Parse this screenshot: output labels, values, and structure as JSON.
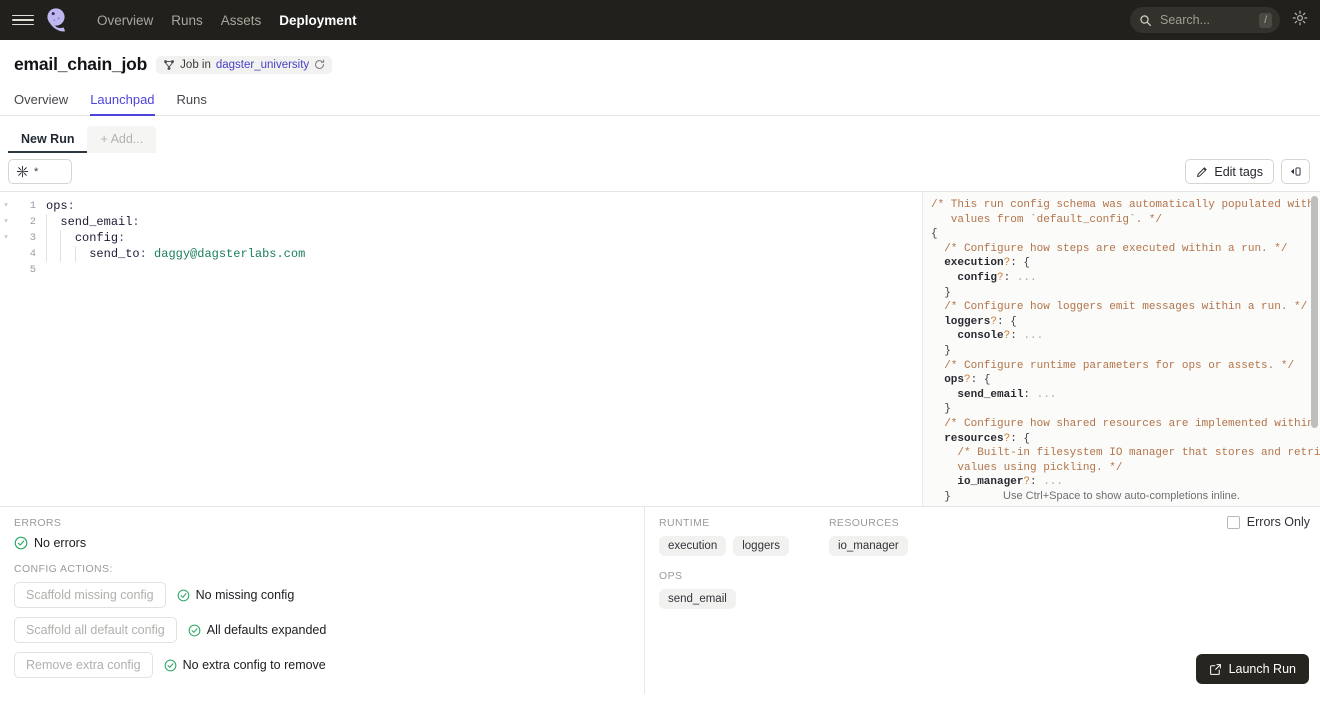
{
  "topnav": {
    "menu_icon": "hamburger-icon",
    "logo_icon": "dagster-logo-icon",
    "links": [
      {
        "label": "Overview",
        "active": false
      },
      {
        "label": "Runs",
        "active": false
      },
      {
        "label": "Assets",
        "active": false
      },
      {
        "label": "Deployment",
        "active": true
      }
    ],
    "search": {
      "placeholder": "Search...",
      "shortcut": "/",
      "icon": "search-icon"
    },
    "settings_icon": "gear-icon"
  },
  "job": {
    "title": "email_chain_job",
    "badge_icon": "job-graph-icon",
    "badge_prefix": "Job in",
    "badge_location": "dagster_university",
    "reload_icon": "refresh-icon"
  },
  "section_tabs": [
    {
      "label": "Overview",
      "active": false
    },
    {
      "label": "Launchpad",
      "active": true
    },
    {
      "label": "Runs",
      "active": false
    }
  ],
  "run_tabs": [
    {
      "label": "New Run",
      "active": true
    },
    {
      "label": "+ Add...",
      "active": false
    }
  ],
  "config_toolbar": {
    "subset_icon": "op-selection-icon",
    "subset_value": "*",
    "edit_tags_label": "Edit tags",
    "edit_tags_icon": "pencil-icon",
    "collapse_icon": "panel-collapse-icon"
  },
  "editor": {
    "line_numbers": [
      "1",
      "2",
      "3",
      "4",
      "5"
    ],
    "lines": [
      {
        "indent": 0,
        "key": "ops",
        "punct": ":",
        "value": ""
      },
      {
        "indent": 1,
        "key": "send_email",
        "punct": ":",
        "value": ""
      },
      {
        "indent": 2,
        "key": "config",
        "punct": ":",
        "value": ""
      },
      {
        "indent": 3,
        "key": "send_to",
        "punct": ": ",
        "value": "daggy@dagsterlabs.com"
      },
      {
        "indent": 0,
        "key": "",
        "punct": "",
        "value": ""
      }
    ]
  },
  "schema": {
    "hint": "Use Ctrl+Space to show auto-completions inline.",
    "lines": [
      {
        "t": "comment",
        "text": "/* This run config schema was automatically populated with default"
      },
      {
        "t": "comment",
        "text": "   values from `default_config`. */"
      },
      {
        "t": "plain",
        "text": "{"
      },
      {
        "t": "comment",
        "text": "  /* Configure how steps are executed within a run. */"
      },
      {
        "t": "key",
        "indent": "  ",
        "key": "execution",
        "opt": "?",
        "tail": ": {"
      },
      {
        "t": "key",
        "indent": "    ",
        "key": "config",
        "opt": "?",
        "tail": ": ",
        "dots": "..."
      },
      {
        "t": "plain",
        "text": "  }"
      },
      {
        "t": "comment",
        "text": "  /* Configure how loggers emit messages within a run. */"
      },
      {
        "t": "key",
        "indent": "  ",
        "key": "loggers",
        "opt": "?",
        "tail": ": {"
      },
      {
        "t": "key",
        "indent": "    ",
        "key": "console",
        "opt": "?",
        "tail": ": ",
        "dots": "..."
      },
      {
        "t": "plain",
        "text": "  }"
      },
      {
        "t": "comment",
        "text": "  /* Configure runtime parameters for ops or assets. */"
      },
      {
        "t": "key",
        "indent": "  ",
        "key": "ops",
        "opt": "?",
        "tail": ": {"
      },
      {
        "t": "key",
        "indent": "    ",
        "key": "send_email",
        "opt": "",
        "tail": ": ",
        "dots": "..."
      },
      {
        "t": "plain",
        "text": "  }"
      },
      {
        "t": "comment",
        "text": "  /* Configure how shared resources are implemented within a run. */"
      },
      {
        "t": "key",
        "indent": "  ",
        "key": "resources",
        "opt": "?",
        "tail": ": {"
      },
      {
        "t": "comment",
        "text": "    /* Built-in filesystem IO manager that stores and retrieves"
      },
      {
        "t": "comment",
        "text": "    values using pickling. */"
      },
      {
        "t": "key",
        "indent": "    ",
        "key": "io_manager",
        "opt": "?",
        "tail": ": ",
        "dots": "..."
      },
      {
        "t": "plain",
        "text": "  }"
      }
    ]
  },
  "errors_panel": {
    "errors_heading": "ERRORS",
    "errors_status": "No errors",
    "actions_heading": "CONFIG ACTIONS:",
    "actions": [
      {
        "button": "Scaffold missing config",
        "status": "No missing config"
      },
      {
        "button": "Scaffold all default config",
        "status": "All defaults expanded"
      },
      {
        "button": "Remove extra config",
        "status": "No extra config to remove"
      }
    ],
    "check_icon": "check-circle-icon"
  },
  "summary_panel": {
    "runtime_heading": "RUNTIME",
    "runtime_pills": [
      "execution",
      "loggers"
    ],
    "resources_heading": "RESOURCES",
    "resources_pills": [
      "io_manager"
    ],
    "ops_heading": "OPS",
    "ops_pills": [
      "send_email"
    ],
    "errors_only_label": "Errors Only",
    "launch_label": "Launch Run",
    "launch_icon": "launch-external-icon"
  },
  "colors": {
    "nav_bg": "#21201C",
    "accent": "#4F43DD",
    "link": "#4A42C7",
    "success": "#2FA866",
    "yaml_value": "#1A7F5A",
    "schema_comment": "#B2744A",
    "launch_bg": "#26251F"
  }
}
